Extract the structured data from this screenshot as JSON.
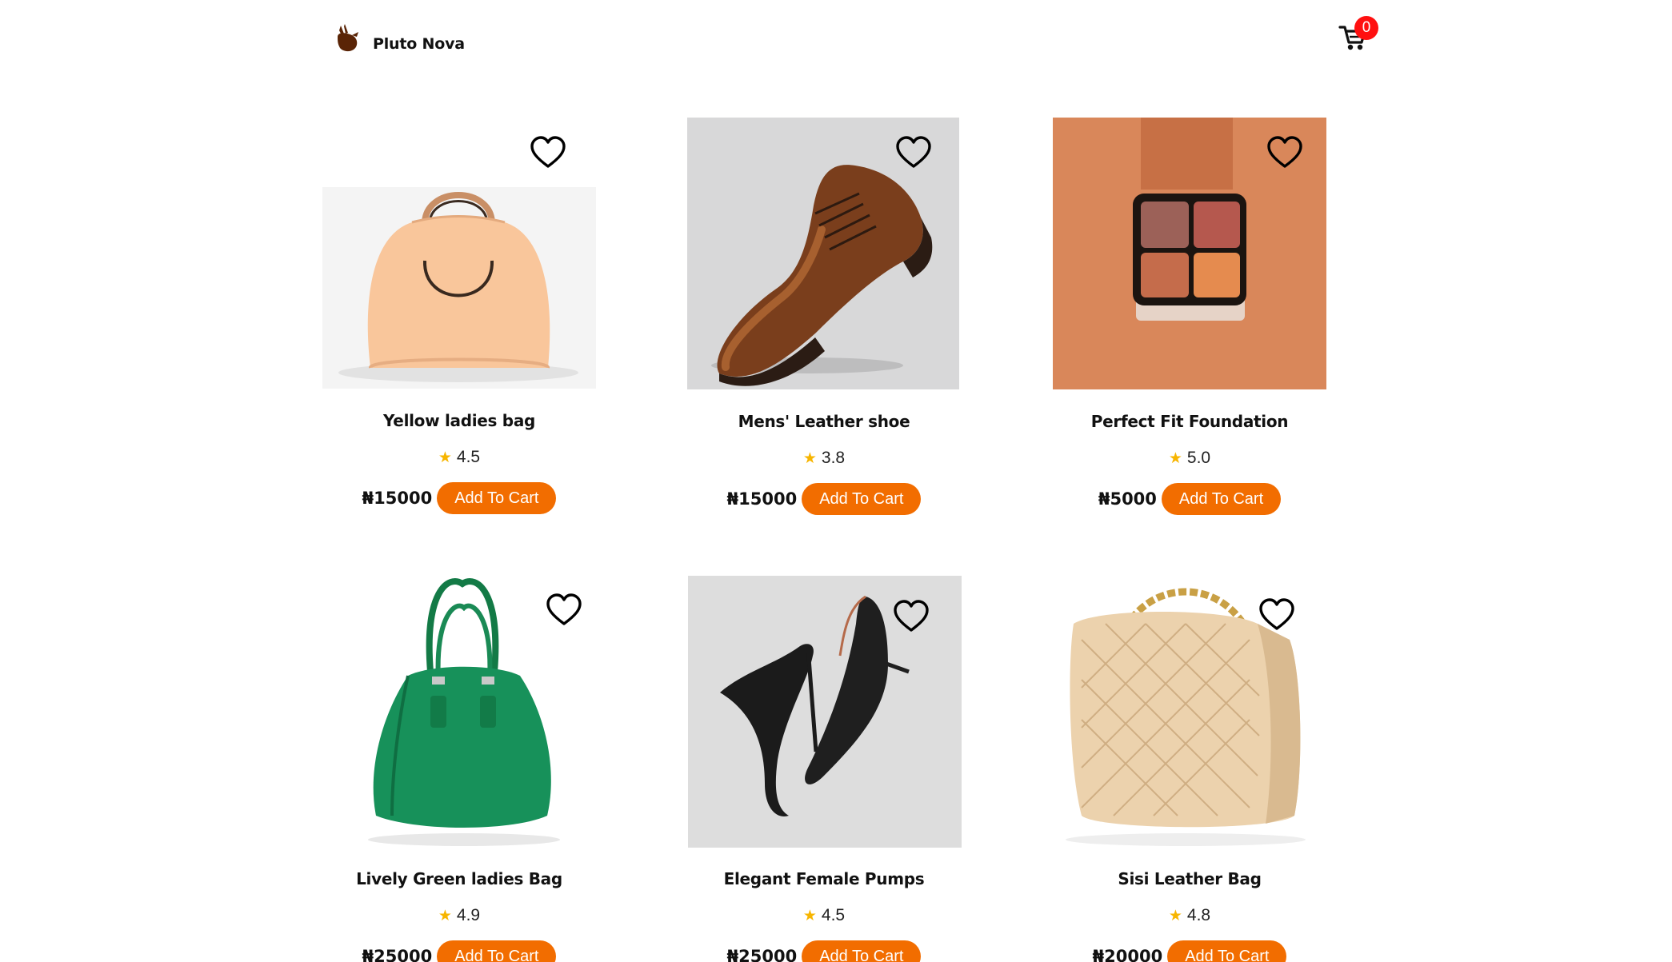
{
  "brand": {
    "name": "Pluto Nova",
    "accent": "#f26d00"
  },
  "cart": {
    "count": "0",
    "icon": "cart-icon"
  },
  "currency": "₦",
  "products": [
    {
      "name": "Yellow ladies bag",
      "rating": "4.5",
      "price": "₦15000",
      "button": "Add To Cart"
    },
    {
      "name": "Mens' Leather shoe",
      "rating": "3.8",
      "price": "₦15000",
      "button": "Add To Cart"
    },
    {
      "name": "Perfect Fit Foundation",
      "rating": "5.0",
      "price": "₦5000",
      "button": "Add To Cart"
    },
    {
      "name": "Lively Green ladies Bag",
      "rating": "4.9",
      "price": "₦25000",
      "button": "Add To Cart"
    },
    {
      "name": "Elegant Female Pumps",
      "rating": "4.5",
      "price": "₦25000",
      "button": "Add To Cart"
    },
    {
      "name": "Sisi Leather Bag",
      "rating": "4.8",
      "price": "₦20000",
      "button": "Add To Cart"
    }
  ]
}
